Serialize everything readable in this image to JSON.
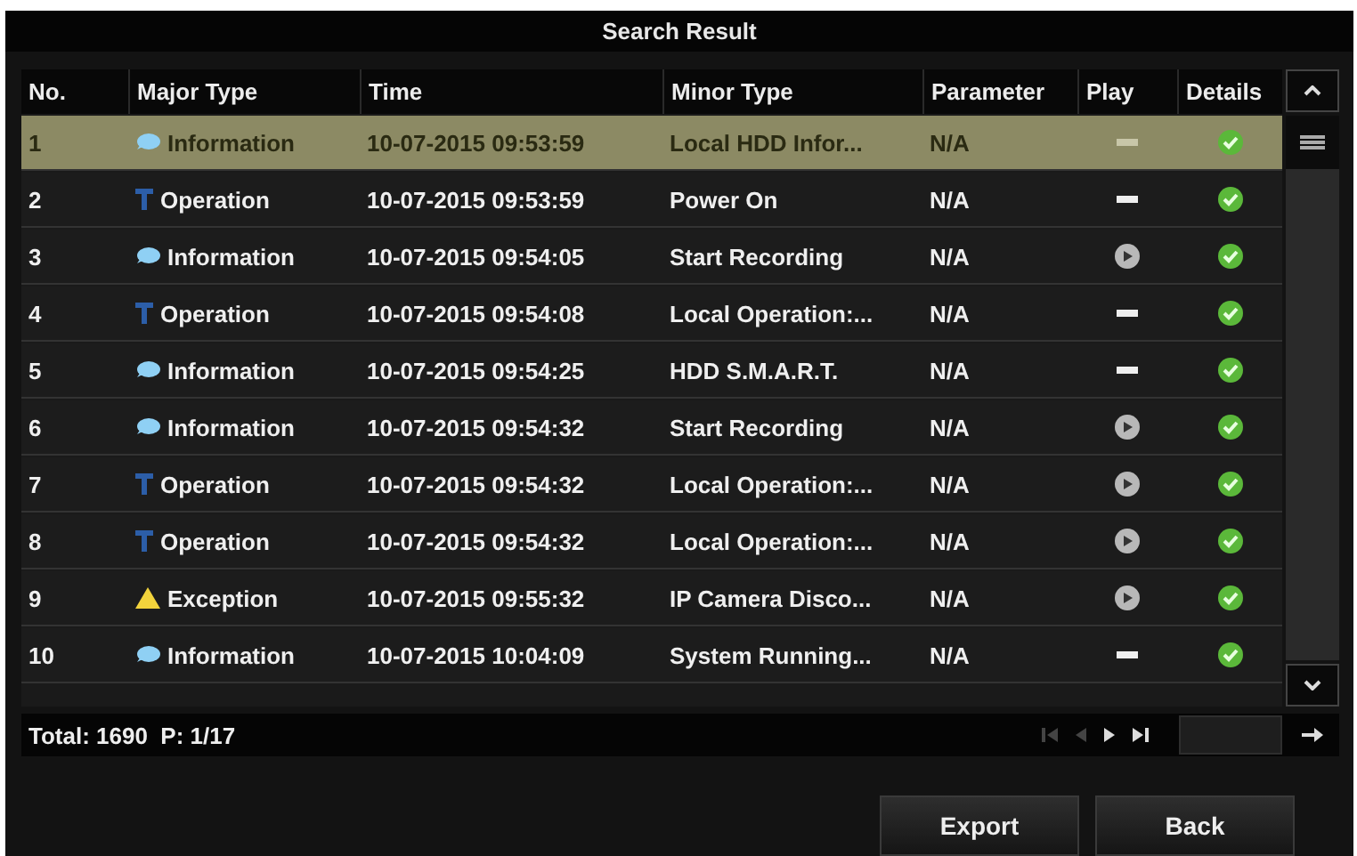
{
  "window": {
    "title": "Search Result"
  },
  "table": {
    "columns": [
      "No.",
      "Major Type",
      "Time",
      "Minor Type",
      "Parameter",
      "Play",
      "Details"
    ],
    "rows": [
      {
        "no": "1",
        "kind": "information",
        "major": "Information",
        "time": "10-07-2015 09:53:59",
        "minor": "Local HDD Infor...",
        "parameter": "N/A",
        "has_video": false,
        "selected": true
      },
      {
        "no": "2",
        "kind": "operation",
        "major": "Operation",
        "time": "10-07-2015 09:53:59",
        "minor": "Power On",
        "parameter": "N/A",
        "has_video": false,
        "selected": false
      },
      {
        "no": "3",
        "kind": "information",
        "major": "Information",
        "time": "10-07-2015 09:54:05",
        "minor": "Start Recording",
        "parameter": "N/A",
        "has_video": true,
        "selected": false
      },
      {
        "no": "4",
        "kind": "operation",
        "major": "Operation",
        "time": "10-07-2015 09:54:08",
        "minor": "Local Operation:...",
        "parameter": "N/A",
        "has_video": false,
        "selected": false
      },
      {
        "no": "5",
        "kind": "information",
        "major": "Information",
        "time": "10-07-2015 09:54:25",
        "minor": "HDD S.M.A.R.T.",
        "parameter": "N/A",
        "has_video": false,
        "selected": false
      },
      {
        "no": "6",
        "kind": "information",
        "major": "Information",
        "time": "10-07-2015 09:54:32",
        "minor": "Start Recording",
        "parameter": "N/A",
        "has_video": true,
        "selected": false
      },
      {
        "no": "7",
        "kind": "operation",
        "major": "Operation",
        "time": "10-07-2015 09:54:32",
        "minor": "Local Operation:...",
        "parameter": "N/A",
        "has_video": true,
        "selected": false
      },
      {
        "no": "8",
        "kind": "operation",
        "major": "Operation",
        "time": "10-07-2015 09:54:32",
        "minor": "Local Operation:...",
        "parameter": "N/A",
        "has_video": true,
        "selected": false
      },
      {
        "no": "9",
        "kind": "exception",
        "major": "Exception",
        "time": "10-07-2015 09:55:32",
        "minor": "IP Camera Disco...",
        "parameter": "N/A",
        "has_video": true,
        "selected": false
      },
      {
        "no": "10",
        "kind": "information",
        "major": "Information",
        "time": "10-07-2015 10:04:09",
        "minor": "System Running...",
        "parameter": "N/A",
        "has_video": false,
        "selected": false
      }
    ]
  },
  "footer": {
    "summary": "Total: 1690  P: 1/17",
    "pager": [
      {
        "kind": "first",
        "disabled": true
      },
      {
        "kind": "prev",
        "disabled": true
      },
      {
        "kind": "next",
        "disabled": false
      },
      {
        "kind": "last",
        "disabled": false
      }
    ]
  },
  "buttons": [
    "Export",
    "Back"
  ]
}
